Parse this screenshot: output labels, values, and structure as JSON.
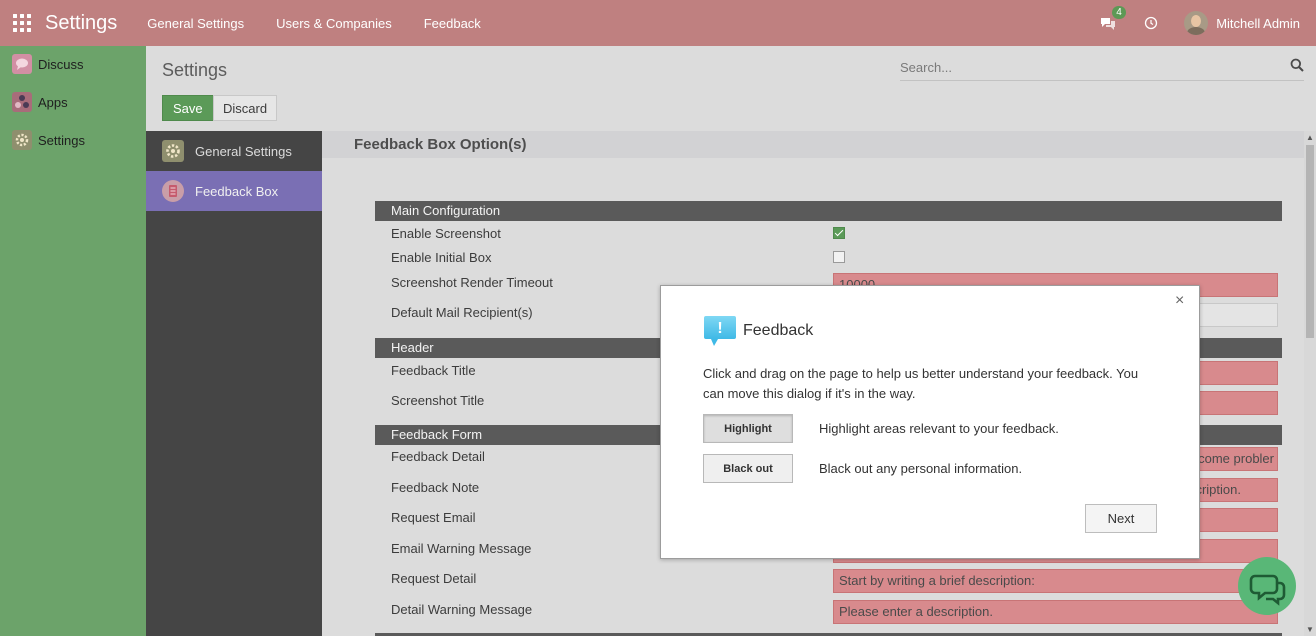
{
  "navbar": {
    "brand": "Settings",
    "menu": [
      "General Settings",
      "Users & Companies",
      "Feedback"
    ],
    "chat_count": "4",
    "user_name": "Mitchell Admin"
  },
  "app_sidebar": {
    "items": [
      {
        "label": "Discuss",
        "icon": "discuss-icon"
      },
      {
        "label": "Apps",
        "icon": "apps-icon"
      },
      {
        "label": "Settings",
        "icon": "settings-icon"
      }
    ]
  },
  "control_panel": {
    "title": "Settings",
    "search_placeholder": "Search...",
    "save_label": "Save",
    "discard_label": "Discard"
  },
  "settings_nav": {
    "items": [
      {
        "label": "General Settings",
        "active": false
      },
      {
        "label": "Feedback Box",
        "active": true
      }
    ]
  },
  "form": {
    "app_title": "Feedback Box Option(s)",
    "sections": [
      {
        "title": "Main Configuration"
      },
      {
        "title": "Header"
      },
      {
        "title": "Feedback Form"
      }
    ],
    "rows": {
      "enable_screenshot": {
        "label": "Enable Screenshot",
        "checked": true
      },
      "enable_initial_box": {
        "label": "Enable Initial Box",
        "checked": false
      },
      "render_timeout": {
        "label": "Screenshot Render Timeout",
        "value": "10000"
      },
      "mail_recipients": {
        "label": "Default Mail Recipient(s)"
      },
      "feedback_title": {
        "label": "Feedback Title"
      },
      "screenshot_title": {
        "label": "Screenshot Title"
      },
      "feedback_detail": {
        "label": "Feedback Detail",
        "value": "come probler"
      },
      "feedback_note": {
        "label": "Feedback Note",
        "value": "cription."
      },
      "request_email": {
        "label": "Request Email"
      },
      "email_warning": {
        "label": "Email Warning Message"
      },
      "request_detail": {
        "label": "Request Detail",
        "value": "Start by writing a brief description:"
      },
      "detail_warning": {
        "label": "Detail Warning Message",
        "value": "Please enter a description."
      }
    }
  },
  "dialog": {
    "title": "Feedback",
    "text": "Click and drag on the page to help us better understand your feedback. You can move this dialog if it's in the way.",
    "highlight_label": "Highlight",
    "highlight_desc": "Highlight areas relevant to your feedback.",
    "blackout_label": "Black out",
    "blackout_desc": "Black out any personal information.",
    "next_label": "Next",
    "close_glyph": "×",
    "icon_glyph": "!"
  },
  "colors": {
    "navbar": "#bf8080",
    "app_sidebar": "#6ca36a",
    "settings_nav": "#454545",
    "active_nav": "#7a6fb4",
    "required_field": "#d88a8d",
    "primary_button": "#5b9a58",
    "chat_fab": "#59b777"
  }
}
